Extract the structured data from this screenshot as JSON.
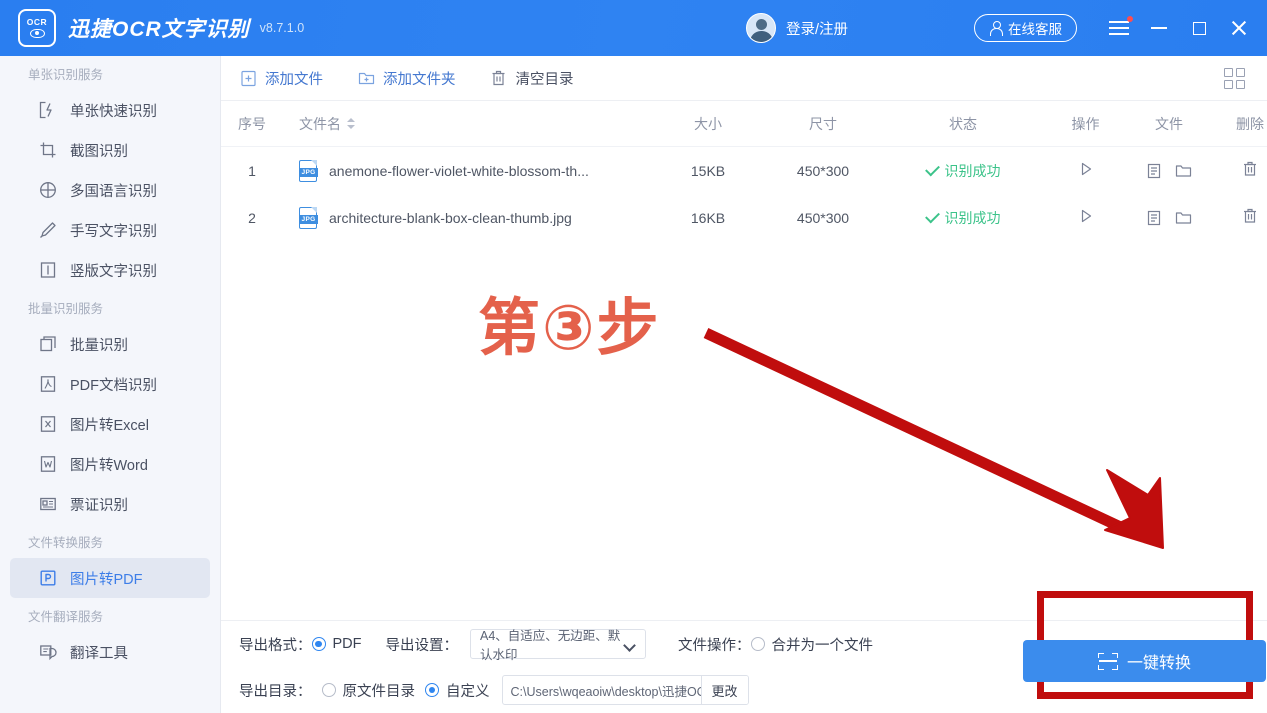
{
  "titlebar": {
    "logo_text": "OCR",
    "app_name": "迅捷OCR文字识别",
    "version": "v8.7.1.0",
    "login_label": "登录/注册",
    "service_label": "在线客服",
    "icons": {
      "menu": "hamburger-icon",
      "minimize": "minimize-icon",
      "maximize": "maximize-icon",
      "close": "close-icon"
    },
    "accent_color": "#2a7ef0"
  },
  "sidebar": {
    "groups": [
      {
        "title": "单张识别服务",
        "items": [
          {
            "label": "单张快速识别",
            "icon": "quick-scan-icon",
            "active": false
          },
          {
            "label": "截图识别",
            "icon": "crop-icon",
            "active": false
          },
          {
            "label": "多国语言识别",
            "icon": "globe-icon",
            "active": false
          },
          {
            "label": "手写文字识别",
            "icon": "pen-icon",
            "active": false
          },
          {
            "label": "竖版文字识别",
            "icon": "vertical-text-icon",
            "active": false
          }
        ]
      },
      {
        "title": "批量识别服务",
        "items": [
          {
            "label": "批量识别",
            "icon": "batch-icon",
            "active": false
          },
          {
            "label": "PDF文档识别",
            "icon": "pdf-icon",
            "active": false
          },
          {
            "label": "图片转Excel",
            "icon": "excel-icon",
            "active": false
          },
          {
            "label": "图片转Word",
            "icon": "word-icon",
            "active": false
          },
          {
            "label": "票证识别",
            "icon": "card-icon",
            "active": false
          }
        ]
      },
      {
        "title": "文件转换服务",
        "items": [
          {
            "label": "图片转PDF",
            "icon": "pdf-convert-icon",
            "active": true
          }
        ]
      },
      {
        "title": "文件翻译服务",
        "items": [
          {
            "label": "翻译工具",
            "icon": "translate-icon",
            "active": false
          }
        ]
      }
    ]
  },
  "toolbar": {
    "add_file_label": "添加文件",
    "add_folder_label": "添加文件夹",
    "clear_list_label": "清空目录",
    "grid_view_icon": "grid-view-icon"
  },
  "table": {
    "headers": {
      "index": "序号",
      "filename": "文件名",
      "size": "大小",
      "dimension": "尺寸",
      "status": "状态",
      "operation": "操作",
      "file": "文件",
      "delete": "删除"
    },
    "rows": [
      {
        "index": "1",
        "filename": "anemone-flower-violet-white-blossom-th...",
        "filetype": "JPG",
        "size": "15KB",
        "dimension": "450*300",
        "status": "识别成功"
      },
      {
        "index": "2",
        "filename": "architecture-blank-box-clean-thumb.jpg",
        "filetype": "JPG",
        "size": "16KB",
        "dimension": "450*300",
        "status": "识别成功"
      }
    ],
    "status_color": "#3cc38a"
  },
  "annotation": {
    "step_text": "第③步",
    "step_color": "#e2543c",
    "arrow_color": "#c00d0d",
    "highlight_box_color": "#c00d0d"
  },
  "bottom": {
    "export_format_label": "导出格式：",
    "export_format_value": "PDF",
    "export_setting_label": "导出设置：",
    "export_setting_value": "A4、自适应、无边距、默认水印",
    "file_operation_label": "文件操作：",
    "file_operation_value": "合并为一个文件",
    "file_operation_checked": false,
    "export_dir_label": "导出目录：",
    "export_dir_option_original": "原文件目录",
    "export_dir_option_custom": "自定义",
    "export_dir_selected": "自定义",
    "export_path": "C:\\Users\\wqeaoiw\\desktop\\迅捷OCR文字识",
    "change_button_label": "更改",
    "convert_button_label": "一键转换"
  }
}
